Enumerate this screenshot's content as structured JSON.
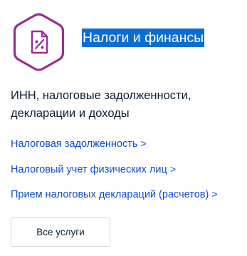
{
  "category": {
    "icon_name": "tax-document-icon",
    "title": "Налоги и финансы",
    "description": "ИНН, налоговые задолженности, декларации и доходы",
    "links": [
      {
        "label": "Налоговая задолженность",
        "chevron": ">"
      },
      {
        "label": "Налоговый учет физических лиц",
        "chevron": ">"
      },
      {
        "label": "Прием налоговых деклараций (расчетов)",
        "chevron": ">"
      }
    ],
    "all_services_label": "Все услуги"
  },
  "colors": {
    "icon_accent": "#9b2d8e",
    "title_highlight_bg": "#0a6ed1",
    "title_highlight_text": "#ffffff",
    "link": "#0d4cd3",
    "text": "#0b1f33",
    "button_border": "#d0d6de"
  }
}
